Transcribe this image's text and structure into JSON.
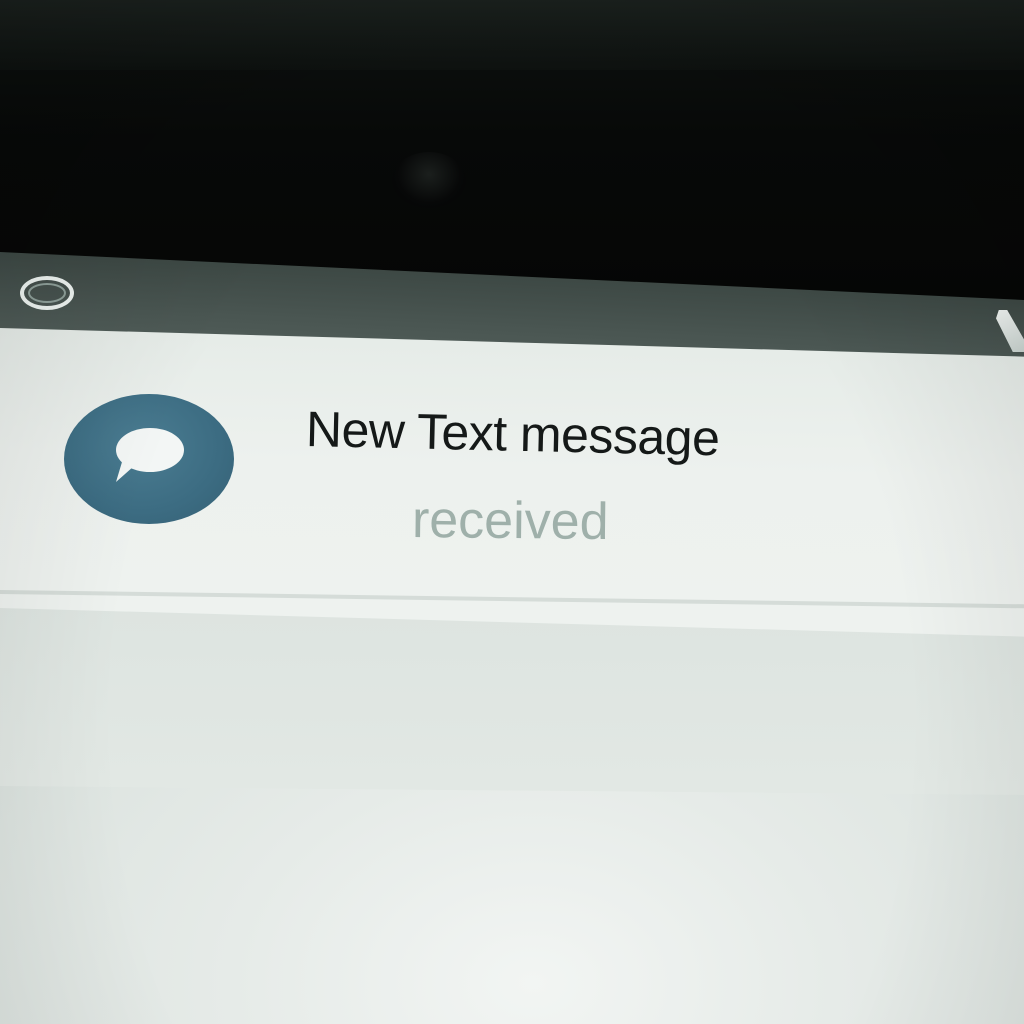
{
  "status_bar": {
    "left_icon": "ring-icon",
    "right_icon": "signal-icon"
  },
  "notification": {
    "app_icon": "chat-bubble-icon",
    "title": "New Text message",
    "subtitle": "received"
  },
  "colors": {
    "icon_background": "#3c6c82",
    "title_text": "#151918",
    "subtitle_text": "#9fb0aa",
    "card_background": "#edf1ee",
    "status_bar": "#4a5652"
  }
}
